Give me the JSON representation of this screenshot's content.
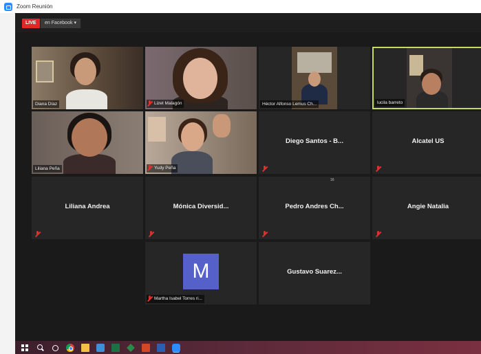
{
  "window": {
    "title": "Zoom Reunión"
  },
  "toolbar": {
    "live_label": "LIVE",
    "on_platform_label": "en Facebook"
  },
  "participants": [
    {
      "name": "Diana Díaz"
    },
    {
      "name": "Lizet Malagón"
    },
    {
      "name": "Héctor Alfonso Lemus Ch..."
    },
    {
      "name": "lucila barreto"
    },
    {
      "name": "Liliana Peña"
    },
    {
      "name": "Yudy Peña"
    },
    {
      "name": "Diego Santos - B..."
    },
    {
      "name": "Alcatel US"
    },
    {
      "name": "Liliana Andrea"
    },
    {
      "name": "Mónica Diversid..."
    },
    {
      "name": "Pedro Andres Ch..."
    },
    {
      "name": "Angie Natalia"
    },
    {
      "name": "Martha Isabel Torres ri...",
      "avatar_letter": "M"
    },
    {
      "name": "Gustavo Suarez..."
    }
  ],
  "counter_text": "16",
  "colors": {
    "active_speaker_border": "#c6dd5a",
    "live": "#e02828",
    "avatar_bg": "#5561c9"
  },
  "taskbar": {
    "icons": [
      "windows-start-icon",
      "search-icon",
      "cortana-icon",
      "chrome-icon",
      "folder-icon",
      "app-icon",
      "excel-icon",
      "app-icon",
      "powerpoint-icon",
      "app-icon",
      "zoom-icon"
    ]
  }
}
